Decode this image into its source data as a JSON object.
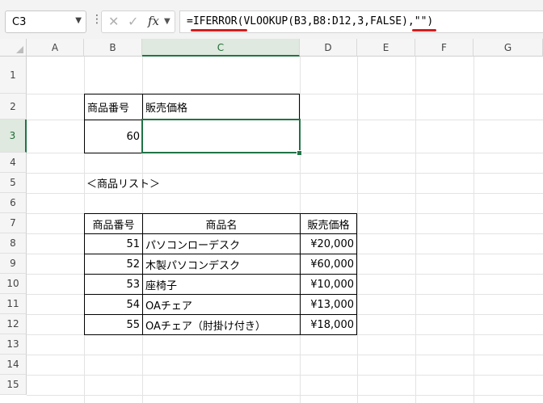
{
  "formula_bar": {
    "name_box": "C3",
    "formula": "=IFERROR(VLOOKUP(B3,B8:D12,3,FALSE),\"\")",
    "cancel_icon": "close-icon",
    "enter_icon": "check-icon",
    "function_label": "fx"
  },
  "columns": [
    "A",
    "B",
    "C",
    "D",
    "E",
    "F",
    "G"
  ],
  "rows": [
    "1",
    "2",
    "3",
    "4",
    "5",
    "6",
    "7",
    "8",
    "9",
    "10",
    "11",
    "12",
    "13",
    "14",
    "15"
  ],
  "selected_cell": "C3",
  "lookup": {
    "header_id": "商品番号",
    "header_price": "販売価格",
    "input_value": "60",
    "result_value": ""
  },
  "list_title": "＜商品リスト＞",
  "product_table": {
    "headers": [
      "商品番号",
      "商品名",
      "販売価格"
    ],
    "rows": [
      [
        "51",
        "パソコンローデスク",
        "¥20,000"
      ],
      [
        "52",
        "木製パソコンデスク",
        "¥60,000"
      ],
      [
        "53",
        "座椅子",
        "¥10,000"
      ],
      [
        "54",
        "OAチェア",
        "¥13,000"
      ],
      [
        "55",
        "OAチェア（肘掛け付き）",
        "¥18,000"
      ]
    ]
  },
  "colors": {
    "selection": "#217346",
    "annotation_underline": "#d81b1b"
  }
}
